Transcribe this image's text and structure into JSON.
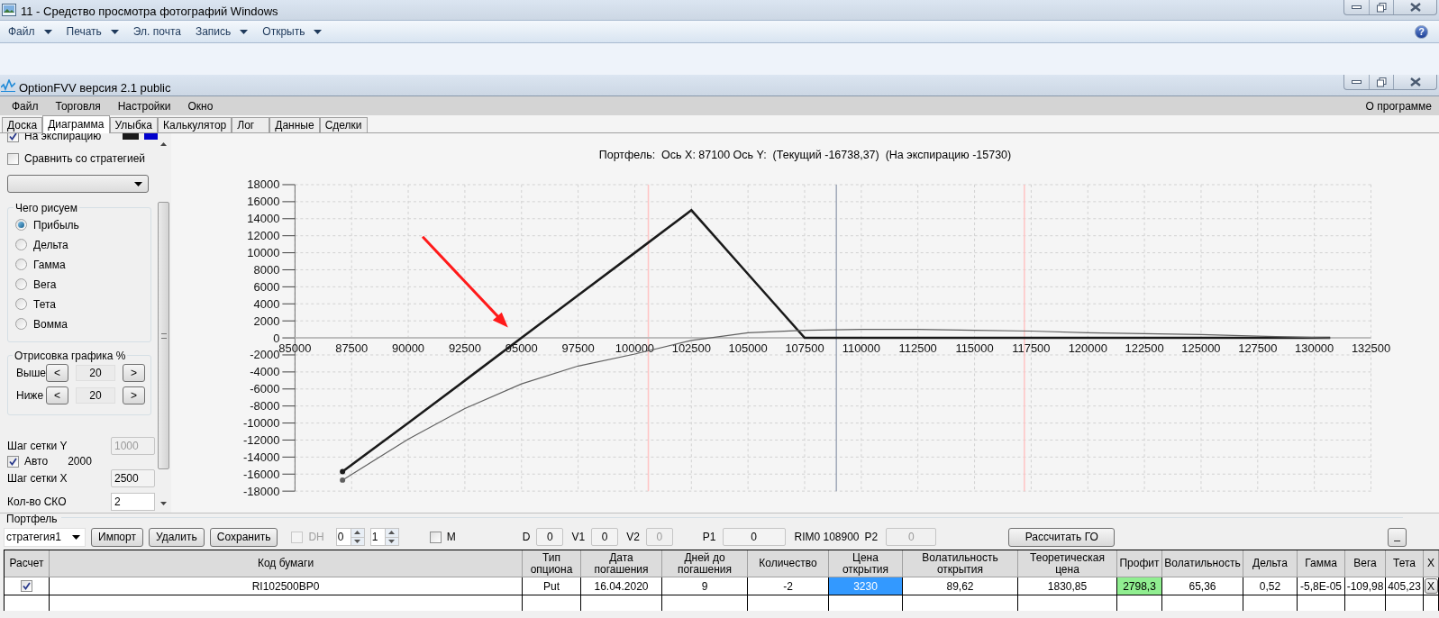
{
  "photo_viewer": {
    "title": "11 - Средство просмотра фотографий Windows",
    "menu": [
      {
        "label": "Файл",
        "dropdown": true
      },
      {
        "label": "Печать",
        "dropdown": true
      },
      {
        "label": "Эл. почта",
        "dropdown": false
      },
      {
        "label": "Запись",
        "dropdown": true
      },
      {
        "label": "Открыть",
        "dropdown": true
      }
    ],
    "help": "?"
  },
  "app": {
    "title": "OptionFVV версия 2.1 public",
    "menu": [
      "Файл",
      "Торговля",
      "Настройки",
      "Окно"
    ],
    "about": "О программе"
  },
  "tabs": [
    {
      "label": "Доска",
      "selected": false
    },
    {
      "label": "Диаграмма",
      "selected": true
    },
    {
      "label": "Улыбка",
      "selected": false
    },
    {
      "label": "Калькулятор",
      "selected": false
    },
    {
      "label": "Лог",
      "selected": false
    },
    {
      "label": "Данные",
      "selected": false
    },
    {
      "label": "Сделки",
      "selected": false
    }
  ],
  "sidebar": {
    "on_expiration": {
      "label": "На экспирацию",
      "checked": true,
      "colors": [
        {
          "color": "#1a1a1a"
        },
        {
          "color": "#0000cc"
        }
      ]
    },
    "compare": {
      "label": "Сравнить со стратегией",
      "checked": false
    },
    "what_to_draw": {
      "title": "Чего рисуем",
      "options": [
        {
          "label": "Прибыль",
          "selected": true
        },
        {
          "label": "Дельта",
          "selected": false
        },
        {
          "label": "Гамма",
          "selected": false
        },
        {
          "label": "Вега",
          "selected": false
        },
        {
          "label": "Тета",
          "selected": false
        },
        {
          "label": "Вомма",
          "selected": false
        }
      ]
    },
    "range": {
      "title": "Отрисовка графика %",
      "rows": [
        {
          "label": "Выше",
          "dec": "<",
          "value": "20",
          "inc": ">"
        },
        {
          "label": "Ниже",
          "dec": "<",
          "value": "20",
          "inc": ">"
        }
      ]
    },
    "grid_y": {
      "label": "Шаг сетки Y",
      "value": "1000",
      "disabled": true
    },
    "auto": {
      "label": "Авто",
      "checked": true,
      "value": "2000"
    },
    "grid_x": {
      "label": "Шаг сетки X",
      "value": "2500",
      "disabled": false
    },
    "sko": {
      "label": "Кол-во СКО",
      "value": "2",
      "disabled": false
    }
  },
  "chart": {
    "chart_data": {
      "type": "line",
      "title": "Портфель:  Ось X: 87100 Ось Y:  (Текущий -16738,37)  (На экспирацию -15730)",
      "x": [
        87100,
        90000,
        92500,
        95000,
        97500,
        100000,
        102500,
        105000,
        107500,
        110000,
        112500,
        115000,
        117500,
        120000,
        122500,
        125000,
        127500,
        130700
      ],
      "series": [
        {
          "color": "#1a1a1a",
          "values": [
            -15700,
            -10000,
            -5000,
            0,
            5000,
            10000,
            15000,
            7500,
            0,
            0,
            0,
            0,
            0,
            0,
            0,
            0,
            0,
            0
          ]
        },
        {
          "color": "#606060",
          "values": [
            -16700,
            -11900,
            -8300,
            -5400,
            -3300,
            -1900,
            -300,
            600,
            900,
            1000,
            1000,
            900,
            800,
            600,
            500,
            400,
            200,
            0
          ]
        }
      ],
      "grid": true,
      "xlim": [
        85000,
        132500
      ],
      "ylim": [
        -18000,
        18000
      ],
      "xticks": [
        85000,
        87500,
        90000,
        92500,
        95000,
        97500,
        100000,
        102500,
        105000,
        107500,
        110000,
        112500,
        115000,
        117500,
        120000,
        122500,
        125000,
        127500,
        130000,
        132500
      ],
      "yticks": [
        18000,
        16000,
        14000,
        12000,
        10000,
        8000,
        6000,
        4000,
        2000,
        0,
        -2000,
        -4000,
        -6000,
        -8000,
        -10000,
        -12000,
        -14000,
        -16000,
        -18000
      ],
      "ref_lines": [
        {
          "axis": "x",
          "value": 100600,
          "color": "#ffc4c4"
        },
        {
          "axis": "x",
          "value": 108900,
          "color": "#a0a8b8"
        },
        {
          "axis": "x",
          "value": 117200,
          "color": "#ffc4c4"
        }
      ]
    }
  },
  "portfolio": {
    "title": "Портфель",
    "strategy": "стратегия1",
    "buttons": [
      "Импорт",
      "Удалить",
      "Сохранить"
    ],
    "dh": {
      "label": "DH",
      "checked": false,
      "disabled": true
    },
    "spinners": [
      "0",
      "1"
    ],
    "m": {
      "label": "M",
      "checked": false
    },
    "fields": [
      {
        "label": "D",
        "value": "0",
        "disabled": false
      },
      {
        "label": "V1",
        "value": "0",
        "disabled": false
      },
      {
        "label": "V2",
        "value": "0",
        "disabled": true
      },
      {
        "label": "P1",
        "value": "0",
        "disabled": false
      }
    ],
    "rim": "RIM0 108900",
    "p2": {
      "label": "P2",
      "value": "0",
      "disabled": true
    },
    "calc_button": "Рассчитать ГО",
    "collapse_button": "_",
    "table": {
      "columns": [
        "Расчет",
        "Код бумаги",
        "Тип\nопциона",
        "Дата\nпогашения",
        "Дней до\nпогашения",
        "Количество",
        "Цена\nоткрытия",
        "Волатильность\nоткрытия",
        "Теоретическая\nцена",
        "Профит",
        "Волатильность",
        "Дельта",
        "Гамма",
        "Вега",
        "Тета",
        "X"
      ],
      "rows": [
        {
          "cells": [
            {
              "kind": "checkbox",
              "checked": true
            },
            {
              "text": "RI102500BP0",
              "selected": false
            },
            {
              "text": "Put",
              "selected": false
            },
            {
              "text": "16.04.2020",
              "selected": false
            },
            {
              "text": "9",
              "selected": false
            },
            {
              "text": "-2",
              "selected": false
            },
            {
              "text": "3230",
              "selected": true
            },
            {
              "text": "89,62",
              "selected": false
            },
            {
              "text": "1830,85",
              "selected": false
            },
            {
              "text": "2798,3",
              "selected": false,
              "color": "#90ee90"
            },
            {
              "text": "65,36",
              "selected": false
            },
            {
              "text": "0,52",
              "selected": false
            },
            {
              "text": "-5,8E-05",
              "selected": false
            },
            {
              "text": "-109,98",
              "selected": false
            },
            {
              "text": "405,23",
              "selected": false
            },
            {
              "kind": "button",
              "text": "X"
            }
          ]
        }
      ]
    }
  }
}
